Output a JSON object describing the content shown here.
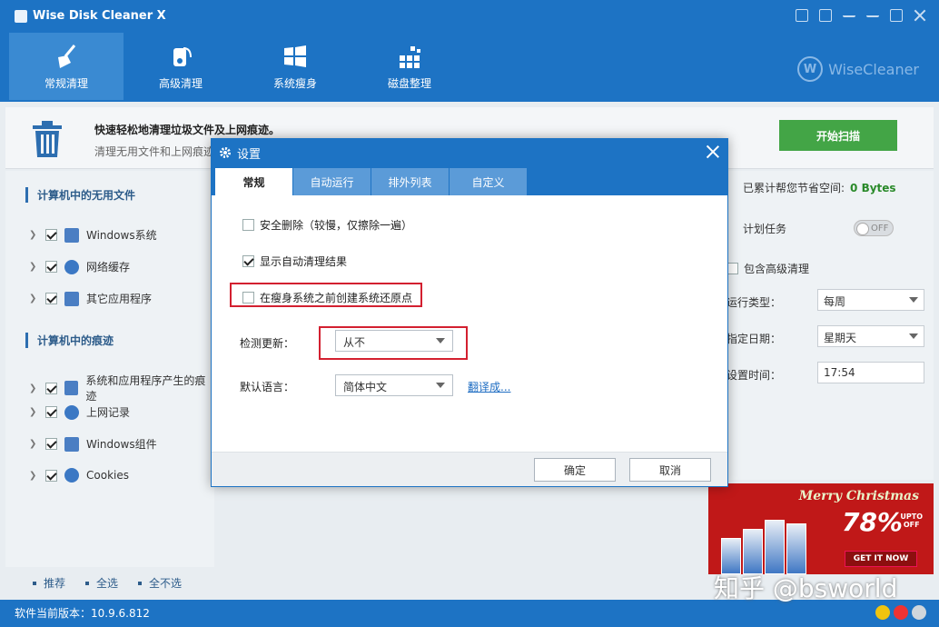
{
  "app": {
    "title": "Wise Disk Cleaner X",
    "brand": "WiseCleaner",
    "version_label": "软件当前版本：10.9.6.812"
  },
  "nav": [
    {
      "label": "常规清理",
      "icon": "broom-icon",
      "active": true
    },
    {
      "label": "高级清理",
      "icon": "deep-clean-icon",
      "active": false
    },
    {
      "label": "系统瘦身",
      "icon": "windows-icon",
      "active": false
    },
    {
      "label": "磁盘整理",
      "icon": "defrag-icon",
      "active": false
    }
  ],
  "header": {
    "title": "快速轻松地清理垃圾文件及上网痕迹。",
    "subtitle": "清理无用文件和上网痕迹",
    "scan_button": "开始扫描"
  },
  "left": {
    "section1": "计算机中的无用文件",
    "section2": "计算机中的痕迹",
    "items1": [
      "Windows系统",
      "网络缓存",
      "其它应用程序"
    ],
    "items2": [
      "系统和应用程序产生的痕迹",
      "上网记录",
      "Windows组件",
      "Cookies"
    ]
  },
  "right": {
    "saved_label": "已累计帮您节省空间:",
    "saved_value": "0 Bytes",
    "schedule_label": "计划任务",
    "toggle_label": "OFF",
    "include_advanced": "包含高级清理",
    "run_type_label": "运行类型：",
    "run_type_value": "每周",
    "date_label": "指定日期：",
    "date_value": "星期天",
    "time_label": "设置时间：",
    "time_value": "17:54"
  },
  "bottom": {
    "recommend": "推荐",
    "select_all": "全选",
    "select_none": "全不选"
  },
  "promo": {
    "title": "Merry Christmas",
    "percent": "78%",
    "upto": "UPTO",
    "off": "OFF",
    "button": "GET IT NOW"
  },
  "watermark": "知乎 @bsworld",
  "dialog": {
    "title": "设置",
    "tabs": [
      "常规",
      "自动运行",
      "排外列表",
      "自定义"
    ],
    "opt_safe_delete": "安全删除（较慢，仅擦除一遍）",
    "opt_show_result": "显示自动清理结果",
    "opt_restore_point": "在瘦身系统之前创建系统还原点",
    "update_label": "检测更新：",
    "update_value": "从不",
    "lang_label": "默认语言：",
    "lang_value": "简体中文",
    "translate_link": "翻译成...",
    "ok": "确定",
    "cancel": "取消"
  }
}
